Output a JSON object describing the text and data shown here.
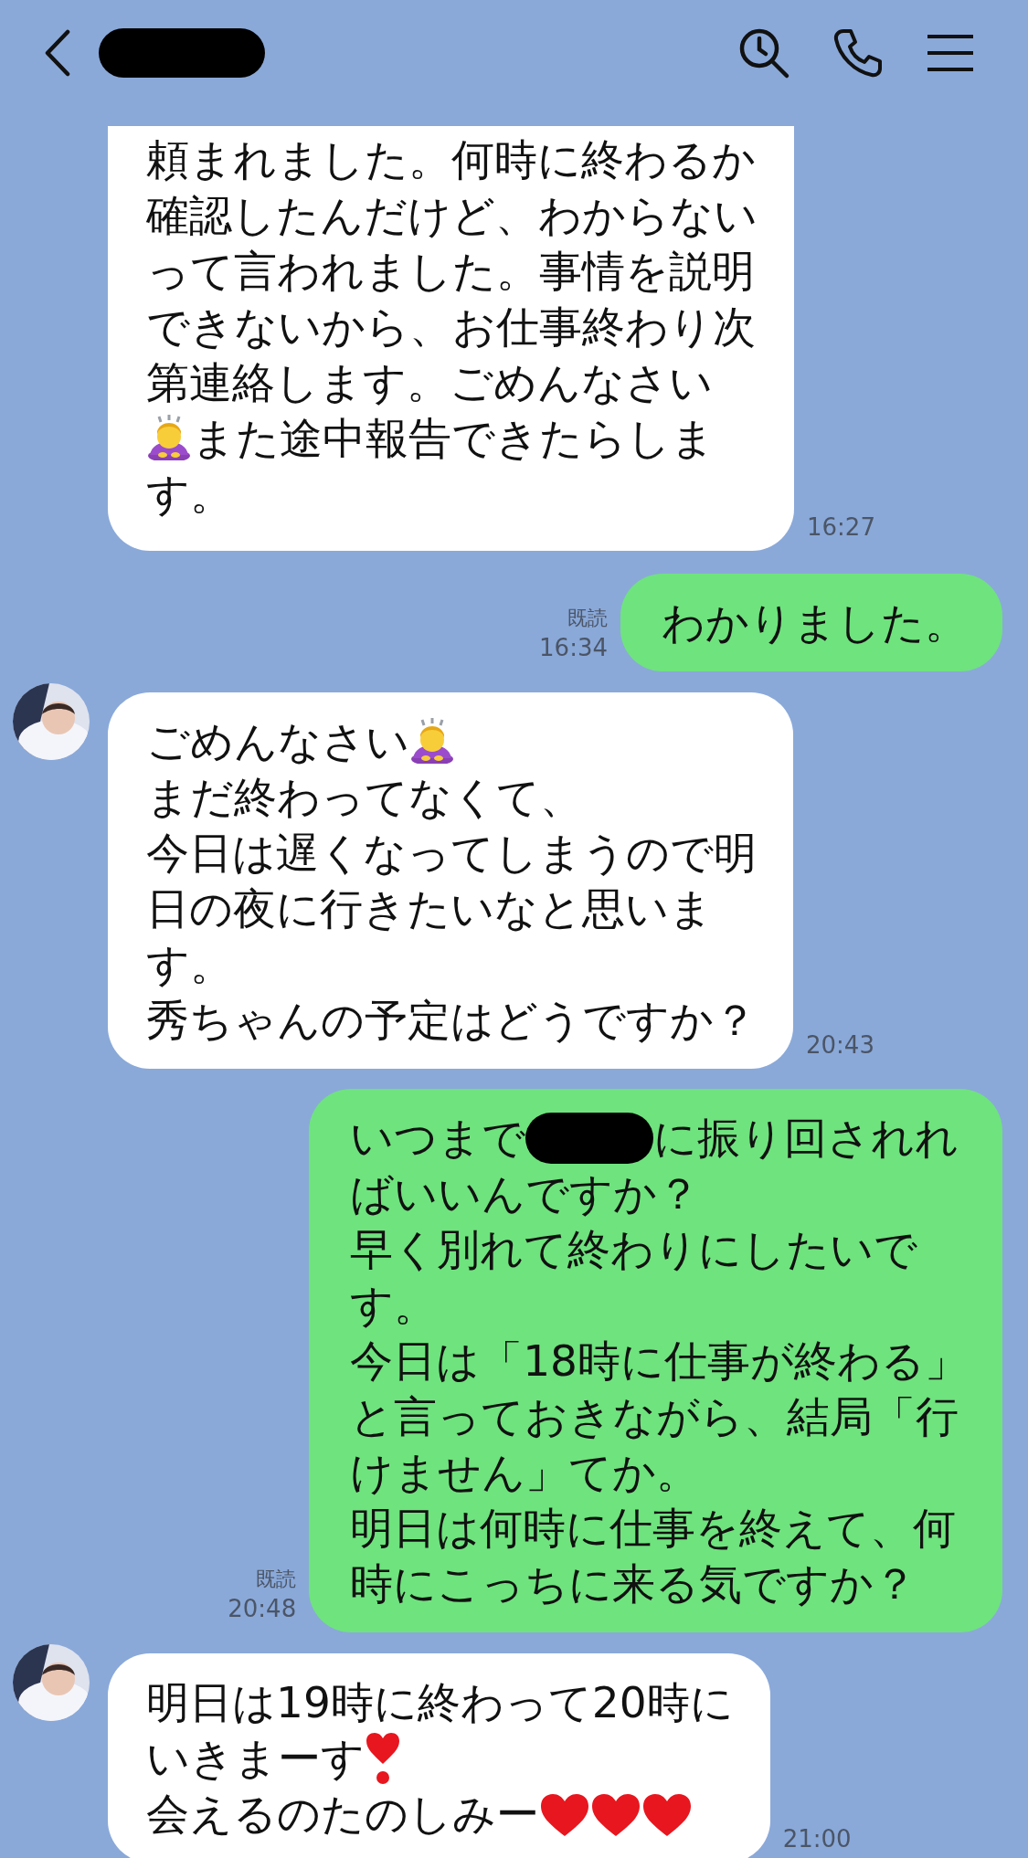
{
  "header": {
    "actions": [
      {
        "kind": "search"
      },
      {
        "kind": "call"
      },
      {
        "kind": "menu"
      }
    ]
  },
  "messages": [
    {
      "kind": "incoming",
      "avatar": false,
      "time": "16:27",
      "lines": [
        [
          {
            "kind": "text",
            "text": "頼まれました。何時に終わるか"
          }
        ],
        [
          {
            "kind": "text",
            "text": "確認したんだけど、わからない"
          }
        ],
        [
          {
            "kind": "text",
            "text": "って言われました。事情を説明"
          }
        ],
        [
          {
            "kind": "text",
            "text": "できないから、お仕事終わり次"
          }
        ],
        [
          {
            "kind": "text",
            "text": "第連絡します。ごめんなさい"
          }
        ],
        [
          {
            "kind": "bow"
          },
          {
            "kind": "text",
            "text": "また途中報告できたらしま"
          }
        ],
        [
          {
            "kind": "text",
            "text": "す。"
          }
        ]
      ]
    },
    {
      "kind": "outgoing",
      "read": "既読",
      "time": "16:34",
      "lines": [
        [
          {
            "kind": "text",
            "text": "わかりました。"
          }
        ]
      ]
    },
    {
      "kind": "incoming",
      "avatar": true,
      "time": "20:43",
      "lines": [
        [
          {
            "kind": "text",
            "text": "ごめんなさい"
          },
          {
            "kind": "bow"
          }
        ],
        [
          {
            "kind": "text",
            "text": "まだ終わってなくて、"
          }
        ],
        [
          {
            "kind": "text",
            "text": "今日は遅くなってしまうので明"
          }
        ],
        [
          {
            "kind": "text",
            "text": "日の夜に行きたいなと思いま"
          }
        ],
        [
          {
            "kind": "text",
            "text": "す。"
          }
        ],
        [
          {
            "kind": "text",
            "text": "秀ちゃんの予定はどうですか？"
          }
        ]
      ]
    },
    {
      "kind": "outgoing",
      "read": "既読",
      "time": "20:48",
      "lines": [
        [
          {
            "kind": "text",
            "text": "いつまで"
          },
          {
            "kind": "redaction"
          },
          {
            "kind": "text",
            "text": "に振り回されれ"
          }
        ],
        [
          {
            "kind": "text",
            "text": "ばいいんですか？"
          }
        ],
        [
          {
            "kind": "text",
            "text": "早く別れて終わりにしたいで"
          }
        ],
        [
          {
            "kind": "text",
            "text": "す。"
          }
        ],
        [
          {
            "kind": "text",
            "text": "今日は「18時に仕事が終わる」"
          }
        ],
        [
          {
            "kind": "text",
            "text": "と言っておきながら、結局「行"
          }
        ],
        [
          {
            "kind": "text",
            "text": "けません」てか。"
          }
        ],
        [
          {
            "kind": "text",
            "text": "明日は何時に仕事を終えて、何"
          }
        ],
        [
          {
            "kind": "text",
            "text": "時にこっちに来る気ですか？"
          }
        ]
      ]
    },
    {
      "kind": "incoming",
      "avatar": true,
      "time": "21:00",
      "lines": [
        [
          {
            "kind": "text",
            "text": "明日は19時に終わって20時に"
          }
        ],
        [
          {
            "kind": "text",
            "text": "いきまーす"
          },
          {
            "kind": "exclamation"
          }
        ],
        [
          {
            "kind": "text",
            "text": "会えるのたのしみー"
          },
          {
            "kind": "heart"
          },
          {
            "kind": "heart"
          },
          {
            "kind": "heart"
          }
        ]
      ]
    }
  ]
}
